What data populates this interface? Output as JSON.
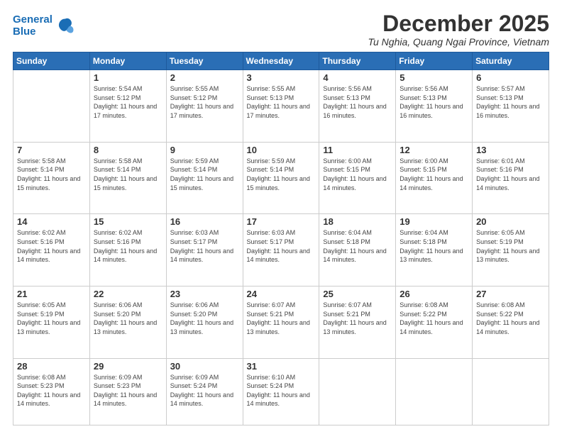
{
  "header": {
    "logo_line1": "General",
    "logo_line2": "Blue",
    "month": "December 2025",
    "location": "Tu Nghia, Quang Ngai Province, Vietnam"
  },
  "weekdays": [
    "Sunday",
    "Monday",
    "Tuesday",
    "Wednesday",
    "Thursday",
    "Friday",
    "Saturday"
  ],
  "weeks": [
    [
      {
        "day": null
      },
      {
        "day": 1,
        "sunrise": "5:54 AM",
        "sunset": "5:12 PM",
        "daylight": "11 hours and 17 minutes."
      },
      {
        "day": 2,
        "sunrise": "5:55 AM",
        "sunset": "5:12 PM",
        "daylight": "11 hours and 17 minutes."
      },
      {
        "day": 3,
        "sunrise": "5:55 AM",
        "sunset": "5:13 PM",
        "daylight": "11 hours and 17 minutes."
      },
      {
        "day": 4,
        "sunrise": "5:56 AM",
        "sunset": "5:13 PM",
        "daylight": "11 hours and 16 minutes."
      },
      {
        "day": 5,
        "sunrise": "5:56 AM",
        "sunset": "5:13 PM",
        "daylight": "11 hours and 16 minutes."
      },
      {
        "day": 6,
        "sunrise": "5:57 AM",
        "sunset": "5:13 PM",
        "daylight": "11 hours and 16 minutes."
      }
    ],
    [
      {
        "day": 7,
        "sunrise": "5:58 AM",
        "sunset": "5:14 PM",
        "daylight": "11 hours and 15 minutes."
      },
      {
        "day": 8,
        "sunrise": "5:58 AM",
        "sunset": "5:14 PM",
        "daylight": "11 hours and 15 minutes."
      },
      {
        "day": 9,
        "sunrise": "5:59 AM",
        "sunset": "5:14 PM",
        "daylight": "11 hours and 15 minutes."
      },
      {
        "day": 10,
        "sunrise": "5:59 AM",
        "sunset": "5:14 PM",
        "daylight": "11 hours and 15 minutes."
      },
      {
        "day": 11,
        "sunrise": "6:00 AM",
        "sunset": "5:15 PM",
        "daylight": "11 hours and 14 minutes."
      },
      {
        "day": 12,
        "sunrise": "6:00 AM",
        "sunset": "5:15 PM",
        "daylight": "11 hours and 14 minutes."
      },
      {
        "day": 13,
        "sunrise": "6:01 AM",
        "sunset": "5:16 PM",
        "daylight": "11 hours and 14 minutes."
      }
    ],
    [
      {
        "day": 14,
        "sunrise": "6:02 AM",
        "sunset": "5:16 PM",
        "daylight": "11 hours and 14 minutes."
      },
      {
        "day": 15,
        "sunrise": "6:02 AM",
        "sunset": "5:16 PM",
        "daylight": "11 hours and 14 minutes."
      },
      {
        "day": 16,
        "sunrise": "6:03 AM",
        "sunset": "5:17 PM",
        "daylight": "11 hours and 14 minutes."
      },
      {
        "day": 17,
        "sunrise": "6:03 AM",
        "sunset": "5:17 PM",
        "daylight": "11 hours and 14 minutes."
      },
      {
        "day": 18,
        "sunrise": "6:04 AM",
        "sunset": "5:18 PM",
        "daylight": "11 hours and 14 minutes."
      },
      {
        "day": 19,
        "sunrise": "6:04 AM",
        "sunset": "5:18 PM",
        "daylight": "11 hours and 13 minutes."
      },
      {
        "day": 20,
        "sunrise": "6:05 AM",
        "sunset": "5:19 PM",
        "daylight": "11 hours and 13 minutes."
      }
    ],
    [
      {
        "day": 21,
        "sunrise": "6:05 AM",
        "sunset": "5:19 PM",
        "daylight": "11 hours and 13 minutes."
      },
      {
        "day": 22,
        "sunrise": "6:06 AM",
        "sunset": "5:20 PM",
        "daylight": "11 hours and 13 minutes."
      },
      {
        "day": 23,
        "sunrise": "6:06 AM",
        "sunset": "5:20 PM",
        "daylight": "11 hours and 13 minutes."
      },
      {
        "day": 24,
        "sunrise": "6:07 AM",
        "sunset": "5:21 PM",
        "daylight": "11 hours and 13 minutes."
      },
      {
        "day": 25,
        "sunrise": "6:07 AM",
        "sunset": "5:21 PM",
        "daylight": "11 hours and 13 minutes."
      },
      {
        "day": 26,
        "sunrise": "6:08 AM",
        "sunset": "5:22 PM",
        "daylight": "11 hours and 14 minutes."
      },
      {
        "day": 27,
        "sunrise": "6:08 AM",
        "sunset": "5:22 PM",
        "daylight": "11 hours and 14 minutes."
      }
    ],
    [
      {
        "day": 28,
        "sunrise": "6:08 AM",
        "sunset": "5:23 PM",
        "daylight": "11 hours and 14 minutes."
      },
      {
        "day": 29,
        "sunrise": "6:09 AM",
        "sunset": "5:23 PM",
        "daylight": "11 hours and 14 minutes."
      },
      {
        "day": 30,
        "sunrise": "6:09 AM",
        "sunset": "5:24 PM",
        "daylight": "11 hours and 14 minutes."
      },
      {
        "day": 31,
        "sunrise": "6:10 AM",
        "sunset": "5:24 PM",
        "daylight": "11 hours and 14 minutes."
      },
      {
        "day": null
      },
      {
        "day": null
      },
      {
        "day": null
      }
    ]
  ]
}
